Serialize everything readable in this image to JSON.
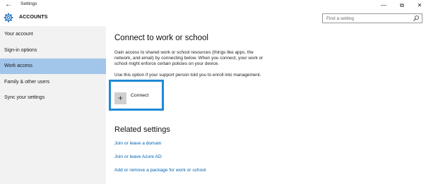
{
  "window": {
    "title": "Settings",
    "back_icon": "back-arrow-icon",
    "minimize_glyph": "—",
    "maximize_glyph": "⧉",
    "close_glyph": "✕"
  },
  "header": {
    "icon": "gear-icon",
    "title": "ACCOUNTS",
    "search_placeholder": "Find a setting"
  },
  "sidebar": {
    "items": [
      {
        "label": "Your account",
        "active": false
      },
      {
        "label": "Sign-in options",
        "active": false
      },
      {
        "label": "Work access",
        "active": true
      },
      {
        "label": "Family & other users",
        "active": false
      },
      {
        "label": "Sync your settings",
        "active": false
      }
    ]
  },
  "main": {
    "heading": "Connect to work or school",
    "description": "Gain access to shared work or school resources (things like apps, the network, and email) by connecting below. When you connect, your work or school might enforce certain policies on your device.",
    "note": "Use this option if your support person told you to enroll into management.",
    "connect": {
      "icon": "plus-icon",
      "label": "Connect"
    },
    "related_heading": "Related settings",
    "links": [
      "Join or leave a domain",
      "Join or leave Azure AD",
      "Add or remove a package for work or school"
    ]
  },
  "colors": {
    "accent": "#0063b1",
    "highlight_frame": "#1e8ad6",
    "active_item": "#a2c5ea",
    "sidebar_bg": "#f2f2f2"
  }
}
